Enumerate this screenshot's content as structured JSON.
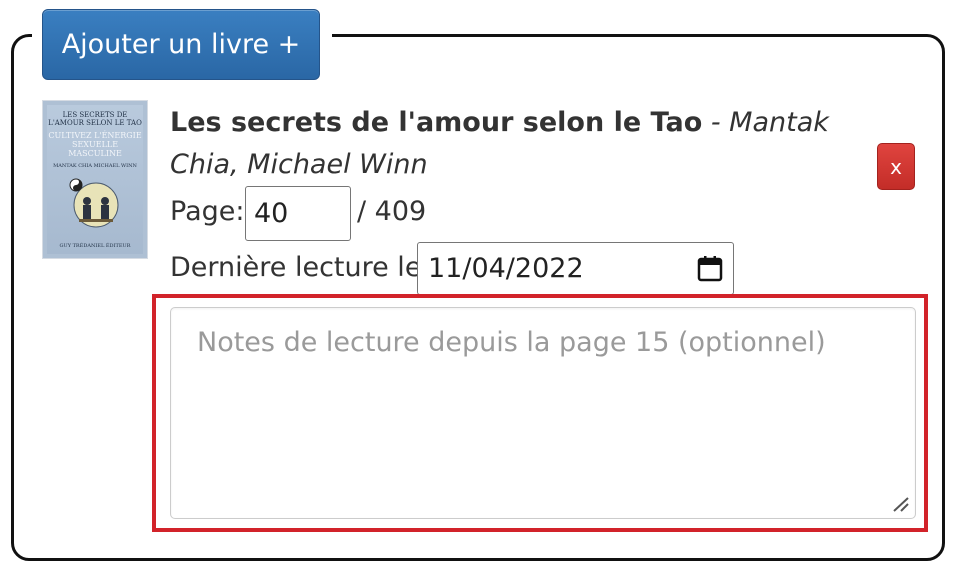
{
  "header": {
    "add_book_label": "Ajouter un livre +"
  },
  "book": {
    "title": "Les secrets de l'amour selon le Tao",
    "author_line": "- Mantak Chia, Michael Winn",
    "remove_label": "x",
    "cover": {
      "line1": "LES SECRETS DE L'AMOUR SELON LE TAO",
      "line2": "CULTIVEZ L'ÉNERGIE SEXUELLE MASCULINE",
      "line3": "MANTAK CHIA MICHAEL WINN",
      "publisher": "GUY TRÉDANIEL ÉDITEUR"
    }
  },
  "progress": {
    "page_label": "Page:",
    "current_page": "40",
    "total_pages": "/ 409",
    "last_read_label": "Dernière lecture le",
    "last_read_date": "11/04/2022"
  },
  "notes": {
    "placeholder": "Notes de lecture depuis la page 15 (optionnel)",
    "value": ""
  },
  "colors": {
    "primary_button": "#2e6da4",
    "danger_button": "#d9383a",
    "highlight": "#d2232a"
  },
  "icons": {
    "calendar": "calendar-icon",
    "resize": "resize-grip-icon"
  }
}
